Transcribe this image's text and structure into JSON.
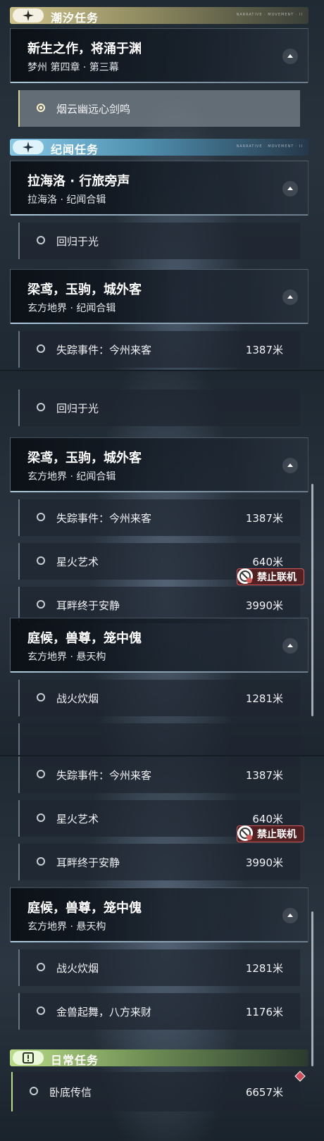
{
  "categories": {
    "tide": {
      "label": "潮汐任务",
      "tail": "NARRATIVE · MOVEMENT · II",
      "icon": "four-point-star-icon",
      "color": "#cfc48c"
    },
    "lore": {
      "label": "纪闻任务",
      "tail": "NARRATIVE · MOVEMENT · II",
      "icon": "four-point-star-icon",
      "color": "#86c9e6"
    },
    "daily": {
      "label": "日常任务",
      "icon": "exclamation-icon",
      "color": "#b9dc86"
    }
  },
  "groups": {
    "newborn": {
      "title": "新生之作，将涌于渊",
      "subtitle": "梦州 第四章 · 第三幕"
    },
    "rinascita": {
      "title": "拉海洛 · 行旅旁声",
      "subtitle": "拉海洛 · 纪闻合辑"
    },
    "liangyuan": {
      "title": "梁鸢，玉驹，城外客",
      "subtitle": "玄方地界 · 纪闻合辑"
    },
    "tinghou": {
      "title": "庭候，兽尊，笼中傀",
      "subtitle": "玄方地界 · 悬天构"
    }
  },
  "quests": {
    "yanyun": {
      "name": "烟云幽远心剑鸣"
    },
    "huigui": {
      "name": "回归于光"
    },
    "shizong": {
      "name": "失踪事件：今州来客",
      "distance": "1387米"
    },
    "xinghuo": {
      "name": "星火艺术",
      "distance": "640米"
    },
    "erpan": {
      "name": "耳畔终于安静",
      "distance": "3990米"
    },
    "zhanhuo": {
      "name": "战火炊烟",
      "distance": "1281米"
    },
    "jinshou": {
      "name": "金兽起舞，八方来财",
      "distance": "1176米"
    },
    "wodi": {
      "name": "卧底传信",
      "distance": "6657米"
    }
  },
  "badges": {
    "no_coop": "禁止联机"
  },
  "colors": {
    "tide": "#cfc48c",
    "lore": "#86c9e6",
    "daily": "#b9dc86",
    "ban": "#d65c5c"
  }
}
